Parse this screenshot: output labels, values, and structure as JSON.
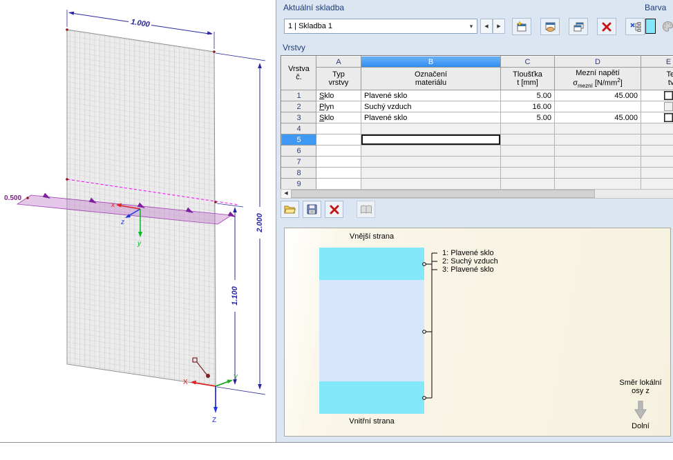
{
  "composition": {
    "title": "Aktuální skladba",
    "value": "1 | Skladba 1"
  },
  "color_panel": {
    "title": "Barva",
    "swatch_color": "#84e8fb"
  },
  "layers": {
    "title": "Vrstvy",
    "corner1": "Vrstva",
    "corner2": "č.",
    "letters": [
      "A",
      "B",
      "C",
      "D",
      "E"
    ],
    "head": {
      "a1": "Typ",
      "a2": "vrstvy",
      "b1": "Označení",
      "b2": "materiálu",
      "c1": "Tloušťka",
      "c2": "t [mm]",
      "d1": "Mezní napětí",
      "d_sigma": "σ",
      "d_sub": "mezní",
      "d_mid": " [N/mm",
      "d_sup": "2",
      "d_end": "]",
      "e1": "Tepelně",
      "e2": "tvrzené"
    },
    "rows": [
      {
        "no": "1",
        "typ": "Sklo",
        "material": "Plavené sklo",
        "t": "5.00",
        "sigma": "45.000"
      },
      {
        "no": "2",
        "typ": "Plyn",
        "material": "Suchý vzduch",
        "t": "16.00",
        "sigma": ""
      },
      {
        "no": "3",
        "typ": "Sklo",
        "material": "Plavené sklo",
        "t": "5.00",
        "sigma": "45.000"
      },
      {
        "no": "4"
      },
      {
        "no": "5"
      },
      {
        "no": "6"
      },
      {
        "no": "7"
      },
      {
        "no": "8"
      },
      {
        "no": "9"
      }
    ]
  },
  "preview": {
    "outer_label": "Vnější strana",
    "inner_label": "Vnitřní strana",
    "legend": [
      "1: Plavené sklo",
      "2: Suchý vzduch",
      "3: Plavené sklo"
    ],
    "dir1": "Směr lokální",
    "dir2": "osy z",
    "dir_bottom": "Dolní",
    "glass_color": "#84e8fb",
    "gas_color": "#d7e7fb"
  },
  "viewport": {
    "dim_width": "1.000",
    "dim_height": "2.000",
    "dim_section": "1.100",
    "dim_band": "0.500",
    "local_axes": {
      "x": "x",
      "y": "y",
      "z": "z"
    },
    "global_axes": {
      "x": "X",
      "y": "Y",
      "z": "Z"
    }
  },
  "colors": {
    "selection": "#3f99f2",
    "dimension": "#26269a",
    "section_line": "#ff00ff"
  }
}
